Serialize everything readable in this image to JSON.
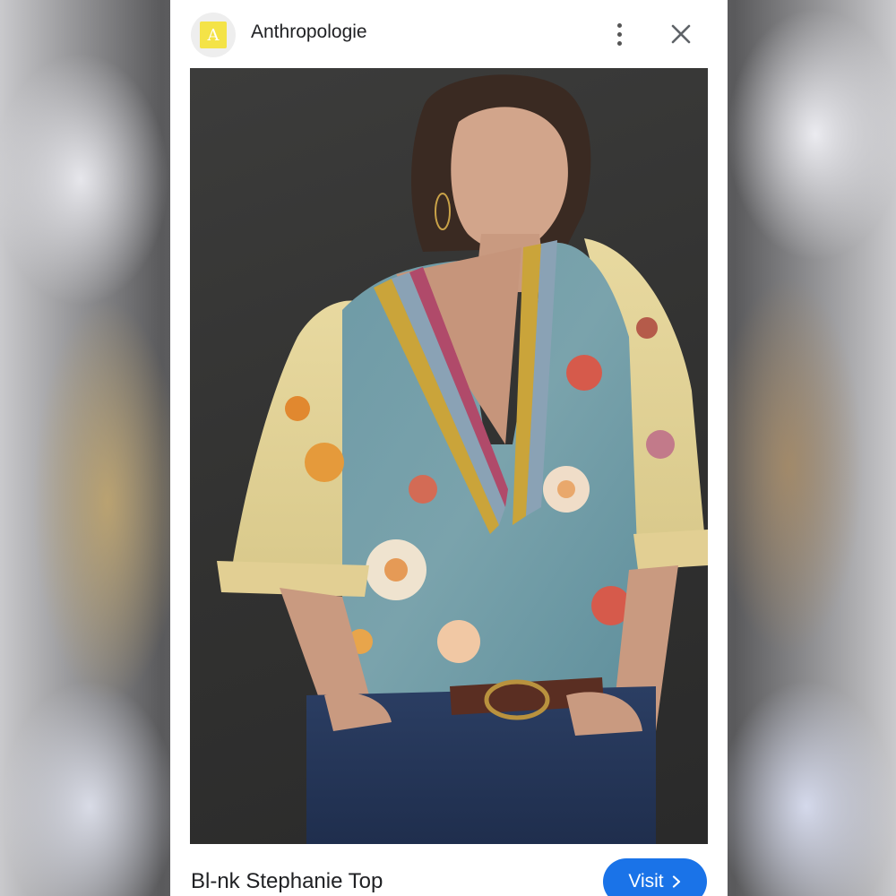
{
  "header": {
    "brand_initial": "A",
    "brand_name": "Anthropologie",
    "more_icon": "more-vert-icon",
    "close_icon": "close-icon"
  },
  "product": {
    "title": "Bl-nk Stephanie Top",
    "visit_label": "Visit",
    "visit_icon": "chevron-right-icon"
  },
  "colors": {
    "accent_button": "#1a73e8",
    "logo_yellow": "#f4e347",
    "photo_background": "#333332"
  }
}
